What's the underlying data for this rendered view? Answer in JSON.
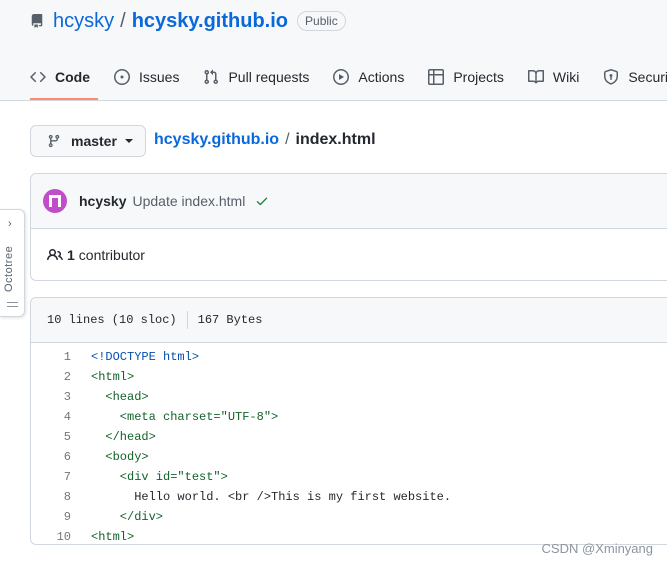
{
  "header": {
    "owner": "hcysky",
    "separator": "/",
    "repo": "hcysky.github.io",
    "visibility": "Public"
  },
  "tabs": [
    {
      "label": "Code",
      "icon": "code-icon",
      "active": true
    },
    {
      "label": "Issues",
      "icon": "issue-icon",
      "active": false
    },
    {
      "label": "Pull requests",
      "icon": "pull-request-icon",
      "active": false
    },
    {
      "label": "Actions",
      "icon": "play-icon",
      "active": false
    },
    {
      "label": "Projects",
      "icon": "table-icon",
      "active": false
    },
    {
      "label": "Wiki",
      "icon": "book-icon",
      "active": false
    },
    {
      "label": "Securit",
      "icon": "shield-icon",
      "active": false
    }
  ],
  "branch": {
    "name": "master"
  },
  "breadcrumb": {
    "repo": "hcysky.github.io",
    "separator": "/",
    "file": "index.html"
  },
  "commit": {
    "user": "hcysky",
    "message": "Update index.html",
    "status": "success"
  },
  "contributors": {
    "count": "1",
    "label": "contributor"
  },
  "file": {
    "lines": "10 lines (10 sloc)",
    "size": "167 Bytes"
  },
  "code_lines": [
    {
      "n": "1",
      "text": "<!DOCTYPE html>"
    },
    {
      "n": "2",
      "text": "<html>"
    },
    {
      "n": "3",
      "text": "  <head>"
    },
    {
      "n": "4",
      "text": "    <meta charset=\"UTF-8\">"
    },
    {
      "n": "5",
      "text": "  </head>"
    },
    {
      "n": "6",
      "text": "  <body>"
    },
    {
      "n": "7",
      "text": "    <div id=\"test\">"
    },
    {
      "n": "8",
      "text": "      Hello world. <br />This is my first website."
    },
    {
      "n": "9",
      "text": "    </div>"
    },
    {
      "n": "10",
      "text": "<html>"
    }
  ],
  "octotree": {
    "label": "Octotree",
    "chevron": "›"
  },
  "watermark": "CSDN @Xminyang",
  "colors": {
    "link": "#0969da",
    "active_tab_underline": "#fd8c73",
    "success": "#1a7f37",
    "avatar": "#c04ec9"
  }
}
